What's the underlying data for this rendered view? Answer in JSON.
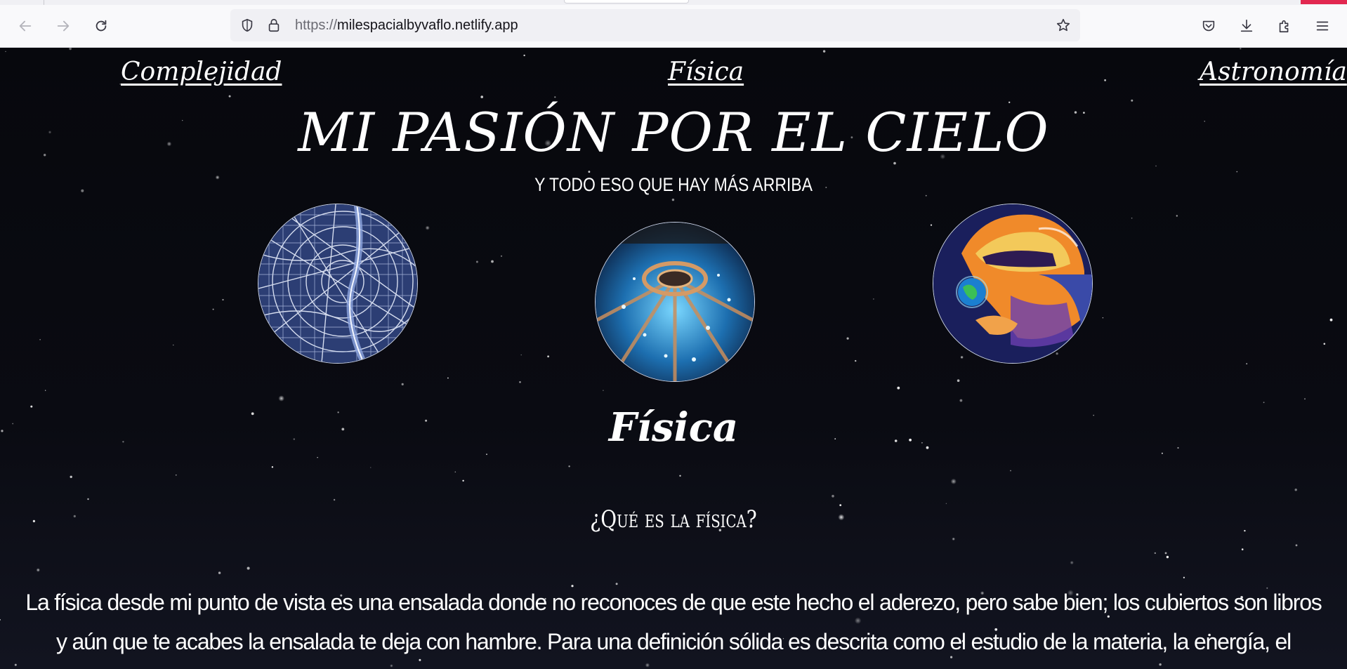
{
  "browser": {
    "url_scheme": "https://",
    "url_host": "milespacialbyvaflo.netlify.app",
    "icons": [
      "back-arrow-icon",
      "forward-arrow-icon",
      "reload-icon",
      "shield-icon",
      "lock-icon",
      "star-icon",
      "pocket-icon",
      "download-icon",
      "extensions-icon",
      "menu-icon"
    ]
  },
  "nav": {
    "left": "Complejidad",
    "center": "Física",
    "right": "Astronomía"
  },
  "hero": {
    "title": "MI PASIÓN POR EL CIELO",
    "subtitle": "Y TODO ESO QUE HAY MÁS ARRIBA"
  },
  "images": [
    "city-map-image",
    "particle-collider-image",
    "astronaut-earth-image"
  ],
  "section": {
    "title": "Física",
    "question": "¿Qué es la física?",
    "paragraph": "La física desde mi punto de vista es una ensalada donde no reconoces de que este hecho el aderezo, pero sabe bien; los cubiertos son libros y aún que te acabes la ensalada te deja con hambre. Para una definición sólida es descrita como el estudio de la materia, la energía, el espacio y el tiempo, nos"
  },
  "colors": {
    "page_background": "#04050a",
    "text": "#ffffff",
    "accent_red": "#e22850"
  }
}
